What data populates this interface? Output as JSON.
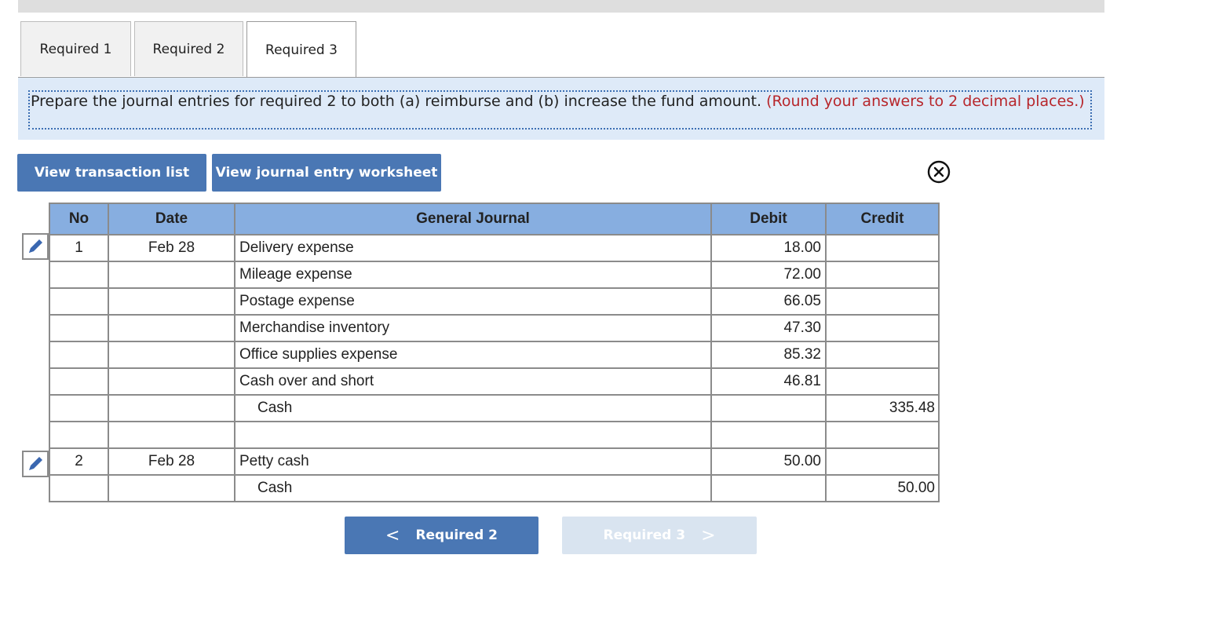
{
  "tabs": [
    {
      "label": "Required 1",
      "active": false
    },
    {
      "label": "Required 2",
      "active": false
    },
    {
      "label": "Required 3",
      "active": true
    }
  ],
  "instruction": {
    "text": "Prepare the journal entries for required 2 to both (a) reimburse and (b) increase the fund amount.",
    "note": "(Round your answers to 2 decimal places.)"
  },
  "buttons": {
    "view_transactions": "View transaction list",
    "view_worksheet": "View journal entry worksheet"
  },
  "journal": {
    "headers": {
      "no": "No",
      "date": "Date",
      "general_journal": "General Journal",
      "debit": "Debit",
      "credit": "Credit"
    },
    "rows": [
      {
        "no": "1",
        "date": "Feb 28",
        "account": "Delivery expense",
        "debit": "18.00",
        "credit": "",
        "indent": false
      },
      {
        "no": "",
        "date": "",
        "account": "Mileage expense",
        "debit": "72.00",
        "credit": "",
        "indent": false
      },
      {
        "no": "",
        "date": "",
        "account": "Postage expense",
        "debit": "66.05",
        "credit": "",
        "indent": false
      },
      {
        "no": "",
        "date": "",
        "account": "Merchandise inventory",
        "debit": "47.30",
        "credit": "",
        "indent": false
      },
      {
        "no": "",
        "date": "",
        "account": "Office supplies expense",
        "debit": "85.32",
        "credit": "",
        "indent": false
      },
      {
        "no": "",
        "date": "",
        "account": "Cash over and short",
        "debit": "46.81",
        "credit": "",
        "indent": false
      },
      {
        "no": "",
        "date": "",
        "account": "Cash",
        "debit": "",
        "credit": "335.48",
        "indent": true
      },
      {
        "no": "",
        "date": "",
        "account": "",
        "debit": "",
        "credit": "",
        "indent": false
      },
      {
        "no": "2",
        "date": "Feb 28",
        "account": "Petty cash",
        "debit": "50.00",
        "credit": "",
        "indent": false
      },
      {
        "no": "",
        "date": "",
        "account": "Cash",
        "debit": "",
        "credit": "50.00",
        "indent": true
      }
    ]
  },
  "navigation": {
    "prev_label": "Required 2",
    "next_label": "Required 3",
    "prev_chevron": "<",
    "next_chevron": ">"
  },
  "icons": {
    "edit": "pencil-icon",
    "close": "close-circle-icon"
  },
  "colors": {
    "primary_button": "#4a77b4",
    "disabled_button": "#d9e4f0",
    "table_header": "#87aee0",
    "instruction_bg": "#deeaf8",
    "note_red": "#b7262b"
  }
}
